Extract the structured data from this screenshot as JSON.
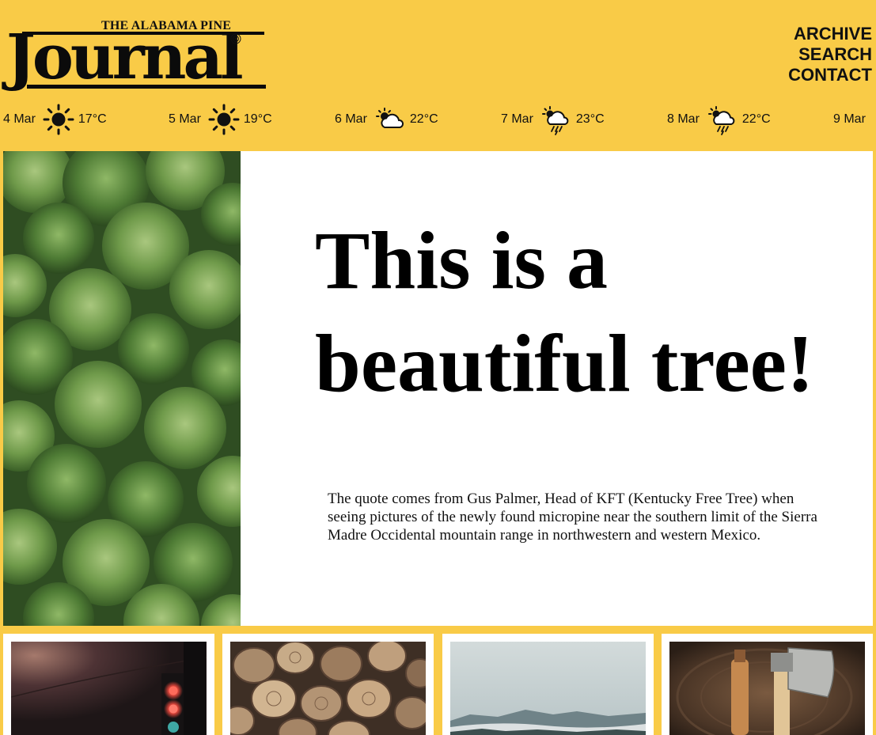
{
  "masthead": {
    "small_title": "THE ALABAMA PINE",
    "big_title": "Journal"
  },
  "nav": {
    "items": [
      "ARCHIVE",
      "SEARCH",
      "CONTACT"
    ]
  },
  "weather": [
    {
      "date": "4 Mar",
      "icon": "sun-icon",
      "temp": "17°C"
    },
    {
      "date": "5 Mar",
      "icon": "sun-icon",
      "temp": "19°C"
    },
    {
      "date": "6 Mar",
      "icon": "partly-cloudy-icon",
      "temp": "22°C"
    },
    {
      "date": "7 Mar",
      "icon": "rain-icon",
      "temp": "23°C"
    },
    {
      "date": "8 Mar",
      "icon": "rain-icon",
      "temp": "22°C"
    },
    {
      "date": "9 Mar",
      "icon": "",
      "temp": ""
    }
  ],
  "hero": {
    "headline": "This is a beautiful tree!",
    "quote": "The quote comes from Gus Palmer, Head of KFT (Kentucky Free Tree) when seeing pictures of the newly found micropine near the southern limit of the Sierra Madre Occidental mountain range in northwestern and western Mexico."
  },
  "cards": [
    {
      "image": "traffic-light-photo"
    },
    {
      "image": "firewood-logs-photo"
    },
    {
      "image": "misty-mountains-photo"
    },
    {
      "image": "axe-and-knife-photo"
    }
  ],
  "colors": {
    "page_background": "#f9cb47",
    "panel_background": "#ffffff",
    "text": "#000000"
  }
}
